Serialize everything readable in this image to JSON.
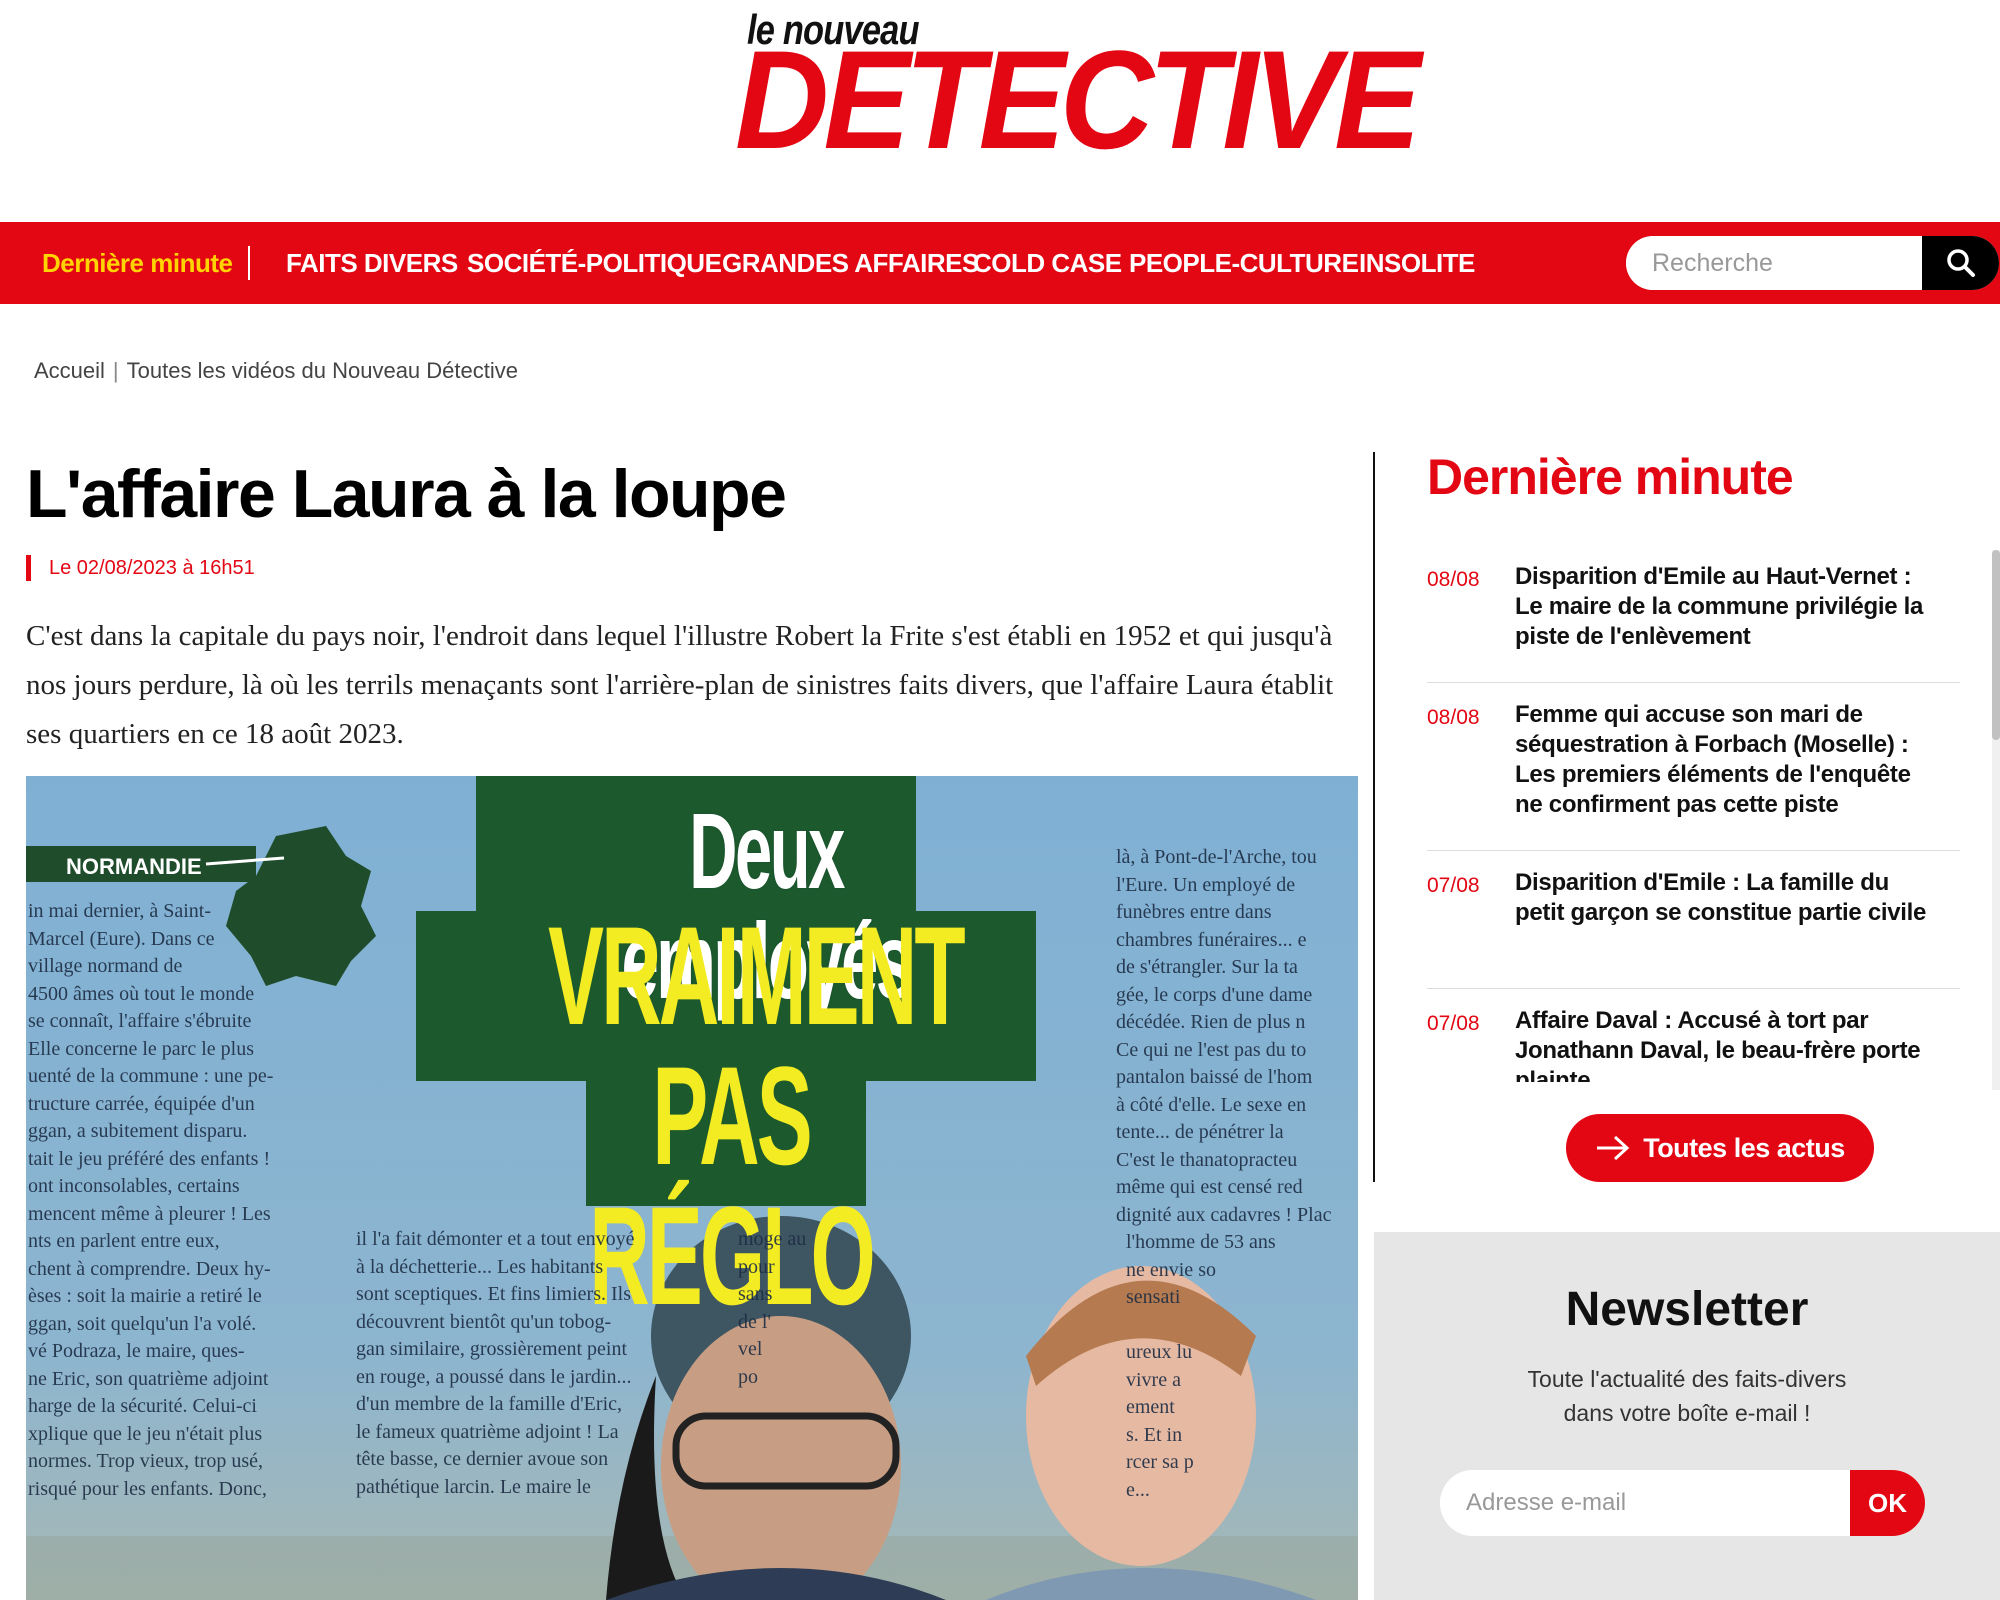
{
  "logo": {
    "top": "le nouveau",
    "main": "DETECTIVE"
  },
  "nav": {
    "items": [
      {
        "label": "Dernière minute"
      },
      {
        "label": "FAITS DIVERS"
      },
      {
        "label": "SOCIÉTÉ-POLITIQUE"
      },
      {
        "label": "GRANDES AFFAIRES"
      },
      {
        "label": "COLD CASE"
      },
      {
        "label": "PEOPLE-CULTURE"
      },
      {
        "label": "INSOLITE"
      }
    ],
    "search_placeholder": "Recherche",
    "search_icon": "search-icon"
  },
  "breadcrumb": {
    "home": "Accueil",
    "current": "Toutes les vidéos du Nouveau Détective"
  },
  "article": {
    "title": "L'affaire Laura à la loupe",
    "date": "Le 02/08/2023 à 16h51",
    "intro": "C'est dans la capitale du pays noir, l'endroit dans lequel l'illustre Robert la Frite s'est établi en 1952 et qui jusqu'à nos jours perdure, là où les terrils menaçants sont l'arrière-plan de sinistres faits divers, que l'affaire Laura établit ses quartiers en ce 18 août 2023.",
    "image": {
      "label": "NORMANDIE",
      "headline_white": "Deux employés",
      "headline_yellow": "VRAIMENT PAS RÉGLO",
      "col1": "in mai dernier, à Saint-\nMarcel (Eure). Dans ce\nvillage normand de\n4500 âmes où tout le monde\nse connaît, l'affaire s'ébruite\nElle concerne le parc le plus\nuenté de la commune : une pe-\ntructure carrée, équipée d'un\nggan, a subitement disparu.\ntait le jeu préféré des enfants !\nont inconsolables, certains\nmencent même à pleurer ! Les\nnts en parlent entre eux,\nchent à comprendre. Deux hy-\nèses : soit la mairie a retiré le\nggan, soit quelqu'un l'a volé.\nvé Podraza, le maire, ques-\nne Eric, son quatrième adjoint\nharge de la sécurité. Celui-ci\nxplique que le jeu n'était plus\nnormes. Trop vieux, trop usé,\nrisqué pour les enfants. Donc,",
      "col2": "il l'a fait démonter et a tout envoyé\nà la déchetterie... Les habitants\nsont sceptiques. Et fins limiers. Ils\ndécouvrent bientôt qu'un tobog-\ngan similaire, grossièrement peint\nen rouge, a poussé dans le jardin...\nd'un membre de la famille d'Eric,\nle fameux quatrième adjoint ! La\ntête basse, ce dernier avoue son\npathétique larcin. Le maire le",
      "col3": "moge au\npour\nsans\nde l'\nvel\npo",
      "col4": "là, à Pont-de-l'Arche, tou\nl'Eure. Un employé de\nfunèbres entre dans\nchambres funéraires... e\nde s'étrangler. Sur la ta\ngée, le corps d'une dame\ndécédée. Rien de plus n\nCe qui ne l'est pas du to\npantalon baissé de l'hom\nà côté d'elle. Le sexe en\ntente... de pénétrer la\nC'est le thanatopracteu\nmême qui est censé red\ndignité aux cadavres ! Plac\n  l'homme de 53 ans\n  ne envie so\n  sensati\n\n  ureux lu\n  vivre a\n  ement\n  s. Et in\n  rcer sa p\n  e..."
    }
  },
  "sidebar": {
    "title": "Dernière minute",
    "news": [
      {
        "date": "08/08",
        "text": "Disparition d'Emile au Haut-Vernet : Le maire de la commune privilégie la piste de l'enlèvement"
      },
      {
        "date": "08/08",
        "text": "Femme qui accuse son mari de séquestration à Forbach (Moselle) : Les premiers éléments de l'enquête ne confirment pas cette piste"
      },
      {
        "date": "07/08",
        "text": "Disparition d'Emile : La famille du petit garçon se constitue partie civile"
      },
      {
        "date": "07/08",
        "text": "Affaire Daval : Accusé à tort par Jonathann Daval, le beau-frère porte plainte"
      }
    ],
    "all_news_label": "Toutes les actus",
    "arrow_icon": "arrow-right-icon"
  },
  "newsletter": {
    "title": "Newsletter",
    "desc_line1": "Toute l'actualité des faits-divers",
    "desc_line2": "dans votre boîte e-mail !",
    "email_placeholder": "Adresse e-mail",
    "ok_label": "OK"
  },
  "colors": {
    "brand_red": "#e30613",
    "highlight_yellow": "#ffd400"
  }
}
